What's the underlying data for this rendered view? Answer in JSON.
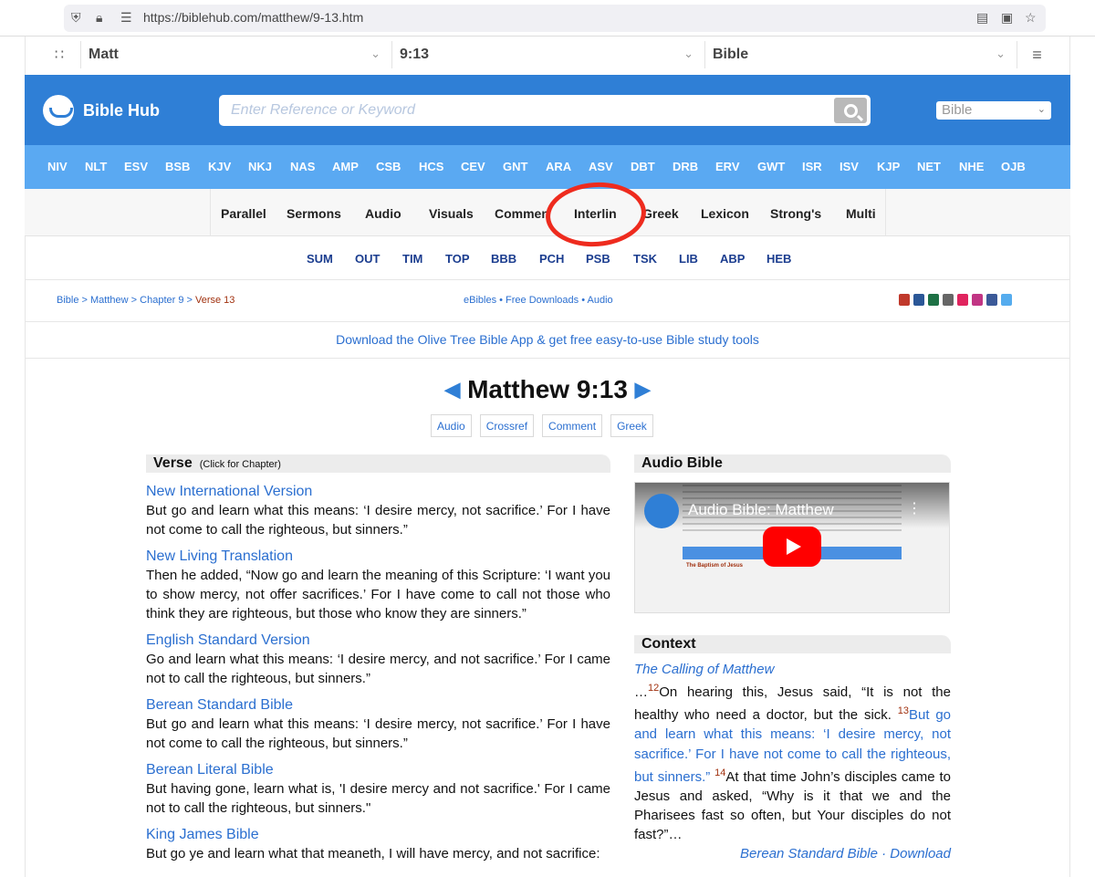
{
  "browser": {
    "url": "https://biblehub.com/matthew/9-13.htm",
    "shield_icon": "shield-icon",
    "lock_icon": "lock-icon"
  },
  "selectors": {
    "book": "Matt",
    "verse": "9:13",
    "bible": "Bible"
  },
  "header": {
    "logo_text": "Bible Hub",
    "search_placeholder": "Enter Reference or Keyword",
    "bible_select": "Bible",
    "brand_color": "#2f7fd6"
  },
  "versions": [
    "NIV",
    "NLT",
    "ESV",
    "BSB",
    "KJV",
    "NKJ",
    "NAS",
    "AMP",
    "CSB",
    "HCS",
    "CEV",
    "GNT",
    "ARA",
    "ASV",
    "DBT",
    "DRB",
    "ERV",
    "GWT",
    "ISR",
    "ISV",
    "KJP",
    "NET",
    "NHE",
    "OJB"
  ],
  "tabs": [
    "Parallel",
    "Sermons",
    "Audio",
    "Visuals",
    "Commen",
    "Interlin",
    "Greek",
    "Lexicon",
    "Strong's",
    "Multi"
  ],
  "subtabs": [
    "SUM",
    "OUT",
    "TIM",
    "TOP",
    "BBB",
    "PCH",
    "PSB",
    "TSK",
    "LIB",
    "ABP",
    "HEB"
  ],
  "breadcrumb": {
    "bible": "Bible",
    "sep1": " > ",
    "book": "Matthew",
    "sep2": " > ",
    "chapter": "Chapter 9",
    "sep3": " > ",
    "verse": "Verse 13"
  },
  "midlinks": {
    "ebibles": "eBibles",
    "dot1": " • ",
    "downloads": "Free Downloads",
    "dot2": " • ",
    "audio": "Audio"
  },
  "promo": "Download the Olive Tree Bible App & get free easy-to-use Bible study tools",
  "title": {
    "prev_arrow": "◀",
    "text": "Matthew 9:13",
    "next_arrow": "▶"
  },
  "pills": [
    "Audio",
    "Crossref",
    "Comment",
    "Greek"
  ],
  "verse_section": {
    "heading": "Verse",
    "sub": "(Click for Chapter)",
    "items": [
      {
        "name": "New International Version",
        "text": "But go and learn what this means: ‘I desire mercy, not sacrifice.’ For I have not come to call the righteous, but sinners.”"
      },
      {
        "name": "New Living Translation",
        "text": "Then he added, “Now go and learn the meaning of this Scripture: ‘I want you to show mercy, not offer sacrifices.’ For I have come to call not those who think they are righteous, but those who know they are sinners.”"
      },
      {
        "name": "English Standard Version",
        "text": "Go and learn what this means: ‘I desire mercy, and not sacrifice.’ For I came not to call the righteous, but sinners.”"
      },
      {
        "name": "Berean Standard Bible",
        "text": "But go and learn what this means: ‘I desire mercy, not sacrifice.’ For I have not come to call the righteous, but sinners.”"
      },
      {
        "name": "Berean Literal Bible",
        "text": "But having gone, learn what is, 'I desire mercy and not sacrifice.' For I came not to call the righteous, but sinners.\""
      },
      {
        "name": "King James Bible",
        "text": "But go ye and learn what that meaneth, I will have mercy, and not sacrifice:"
      }
    ]
  },
  "audio_section": {
    "heading": "Audio Bible",
    "video_title": "Audio Bible: Matthew",
    "video_subhead": "The Baptism of Jesus",
    "menu_dots": "⋮"
  },
  "context_section": {
    "heading": "Context",
    "title": "The Calling of Matthew",
    "lead": "…",
    "v12": "12",
    "t12": "On hearing this, Jesus said, “It is not the healthy who need a doctor, but the sick. ",
    "v13": "13",
    "t13": "But go and learn what this means: ‘I desire mercy, not sacrifice.’ For I have not come to call the righteous, but sinners.”",
    "v14": "14",
    "t14": "At that time John’s disciples came to Jesus and asked, “Why is it that we and the Pharisees fast so often, but Your disciples do not fast?”…",
    "footer": "Berean Standard Bible · Download"
  }
}
